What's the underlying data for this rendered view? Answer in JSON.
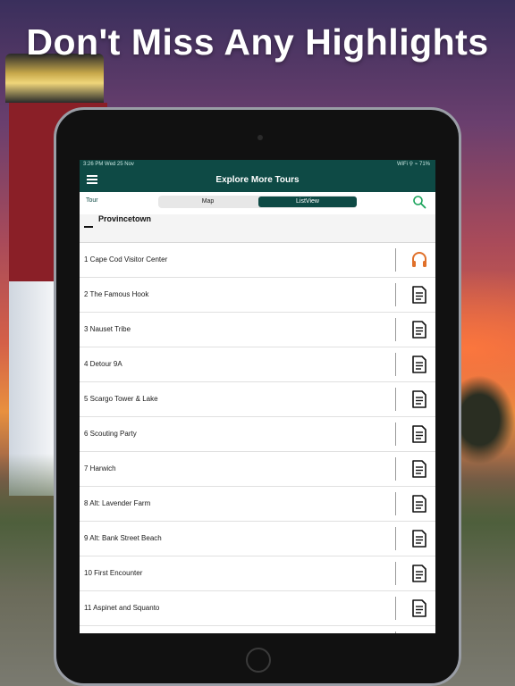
{
  "headline": "Don't Miss Any Highlights",
  "status": {
    "time": "3:26 PM  Wed 25 Nov",
    "right": "WiFi ⚲ ⌁ 71%"
  },
  "nav": {
    "title": "Explore More Tours"
  },
  "toolbar": {
    "tour_label": "Tour",
    "map_label": "Map",
    "list_label": "ListView"
  },
  "section": {
    "title": "Provincetown"
  },
  "stops": [
    {
      "label": "1 Cape Cod Visitor Center",
      "icon": "headphones-icon"
    },
    {
      "label": "2 The Famous Hook",
      "icon": "document-icon"
    },
    {
      "label": "3 Nauset Tribe",
      "icon": "document-icon"
    },
    {
      "label": "4 Detour 9A",
      "icon": "document-icon"
    },
    {
      "label": "5 Scargo Tower & Lake",
      "icon": "document-icon"
    },
    {
      "label": "6 Scouting Party",
      "icon": "document-icon"
    },
    {
      "label": "7 Harwich",
      "icon": "document-icon"
    },
    {
      "label": "8 Alt: Lavender Farm",
      "icon": "document-icon"
    },
    {
      "label": "9 Alt: Bank Street Beach",
      "icon": "document-icon"
    },
    {
      "label": "10 First Encounter",
      "icon": "document-icon"
    },
    {
      "label": "11 Aspinet and Squanto",
      "icon": "document-icon"
    }
  ],
  "colors": {
    "brand": "#0e4a45",
    "headphones": "#e0702a"
  }
}
